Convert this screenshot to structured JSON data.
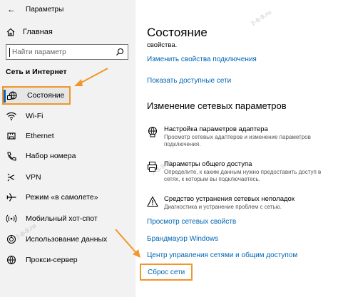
{
  "window": {
    "title": "Параметры"
  },
  "sidebar": {
    "home_label": "Главная",
    "search_placeholder": "Найти параметр",
    "group_title": "Сеть и Интернет",
    "items": [
      {
        "label": "Состояние",
        "icon": "status-globe-icon",
        "selected": true
      },
      {
        "label": "Wi-Fi",
        "icon": "wifi-icon"
      },
      {
        "label": "Ethernet",
        "icon": "ethernet-icon"
      },
      {
        "label": "Набор номера",
        "icon": "dialup-phone-icon"
      },
      {
        "label": "VPN",
        "icon": "vpn-icon"
      },
      {
        "label": "Режим «в самолете»",
        "icon": "airplane-icon"
      },
      {
        "label": "Мобильный хот-спот",
        "icon": "hotspot-icon"
      },
      {
        "label": "Использование данных",
        "icon": "data-usage-icon"
      },
      {
        "label": "Прокси-сервер",
        "icon": "globe-icon"
      }
    ]
  },
  "main": {
    "title": "Состояние",
    "truncated_text": "свойства.",
    "link_change_props": "Изменить свойства подключения",
    "link_show_networks": "Показать доступные сети",
    "section_title": "Изменение сетевых параметров",
    "options": [
      {
        "title": "Настройка параметров адаптера",
        "desc": "Просмотр сетевых адаптеров и изменение параметров подключения.",
        "icon": "adapter-globe-icon"
      },
      {
        "title": "Параметры общего доступа",
        "desc": "Определите, к каким данным нужно предоставить доступ в сетях, к которым вы подключаетесь.",
        "icon": "sharing-printer-icon"
      },
      {
        "title": "Средство устранения сетевых неполадок",
        "desc": "Диагностика и устранение проблем с сетью.",
        "icon": "warning-icon"
      }
    ],
    "links": [
      "Просмотр сетевых свойств",
      "Брандмауэр Windows",
      "Центр управления сетями и общим доступом"
    ],
    "reset_label": "Сброс сети"
  },
  "colors": {
    "accent": "#0067c0",
    "link": "#0066b4",
    "highlight": "#f0962a",
    "sidebar_bg": "#f2f2f2"
  }
}
